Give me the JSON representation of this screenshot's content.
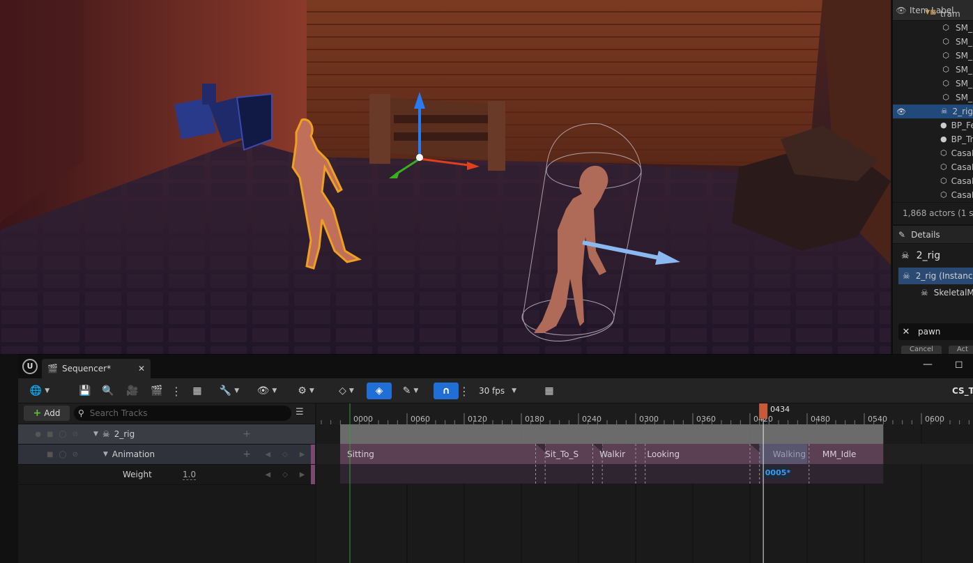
{
  "outliner": {
    "header_label": "Item Label",
    "folder_label": "tram",
    "rows": [
      {
        "label": "SM_",
        "icon": "static-mesh-icon"
      },
      {
        "label": "SM_",
        "icon": "static-mesh-icon"
      },
      {
        "label": "SM_",
        "icon": "static-mesh-icon"
      },
      {
        "label": "SM_",
        "icon": "static-mesh-icon"
      },
      {
        "label": "SM_",
        "icon": "static-mesh-icon"
      },
      {
        "label": "SM_",
        "icon": "static-mesh-icon"
      },
      {
        "label": "2_rig",
        "icon": "skeleton-icon",
        "selected": true
      },
      {
        "label": "BP_Fe",
        "icon": "actor-icon"
      },
      {
        "label": "BP_Tr",
        "icon": "actor-icon"
      },
      {
        "label": "CasaE",
        "icon": "static-mesh-icon"
      },
      {
        "label": "CasaE",
        "icon": "static-mesh-icon"
      },
      {
        "label": "CasaE",
        "icon": "static-mesh-icon"
      },
      {
        "label": "CasaE",
        "icon": "static-mesh-icon"
      }
    ],
    "footer": "1,868 actors (1 se"
  },
  "details": {
    "tab_label": "Details",
    "actor_name": "2_rig",
    "component_selected": "2_rig (Instance",
    "component_child": "SkeletalM",
    "search_value": "pawn",
    "btn1": "Cancel",
    "btn2": "Act"
  },
  "sequencer": {
    "tab_label": "Sequencer*",
    "fps_label": "30 fps",
    "crop_label": "CS_T",
    "add_label": "Add",
    "search_placeholder": "Search Tracks",
    "tracks": {
      "rig": "2_rig",
      "animation": "Animation",
      "weight": "Weight",
      "weight_value": "1.0"
    },
    "playhead_label": "0434",
    "ticks": [
      "0000",
      "0060",
      "0120",
      "0180",
      "0240",
      "0300",
      "0360",
      "0420",
      "0480",
      "0540",
      "0600"
    ],
    "sections": [
      "Sitting",
      "Sit_To_S",
      "Walkir",
      "Looking",
      "Walking",
      "MM_Idle"
    ],
    "key_badge": "0005*"
  },
  "colors": {
    "accent": "#1f6fd6",
    "selection": "#214a7a",
    "section": "#5a4052",
    "playhead": "#c85a3a",
    "highlight_outline": "#f0a020"
  }
}
